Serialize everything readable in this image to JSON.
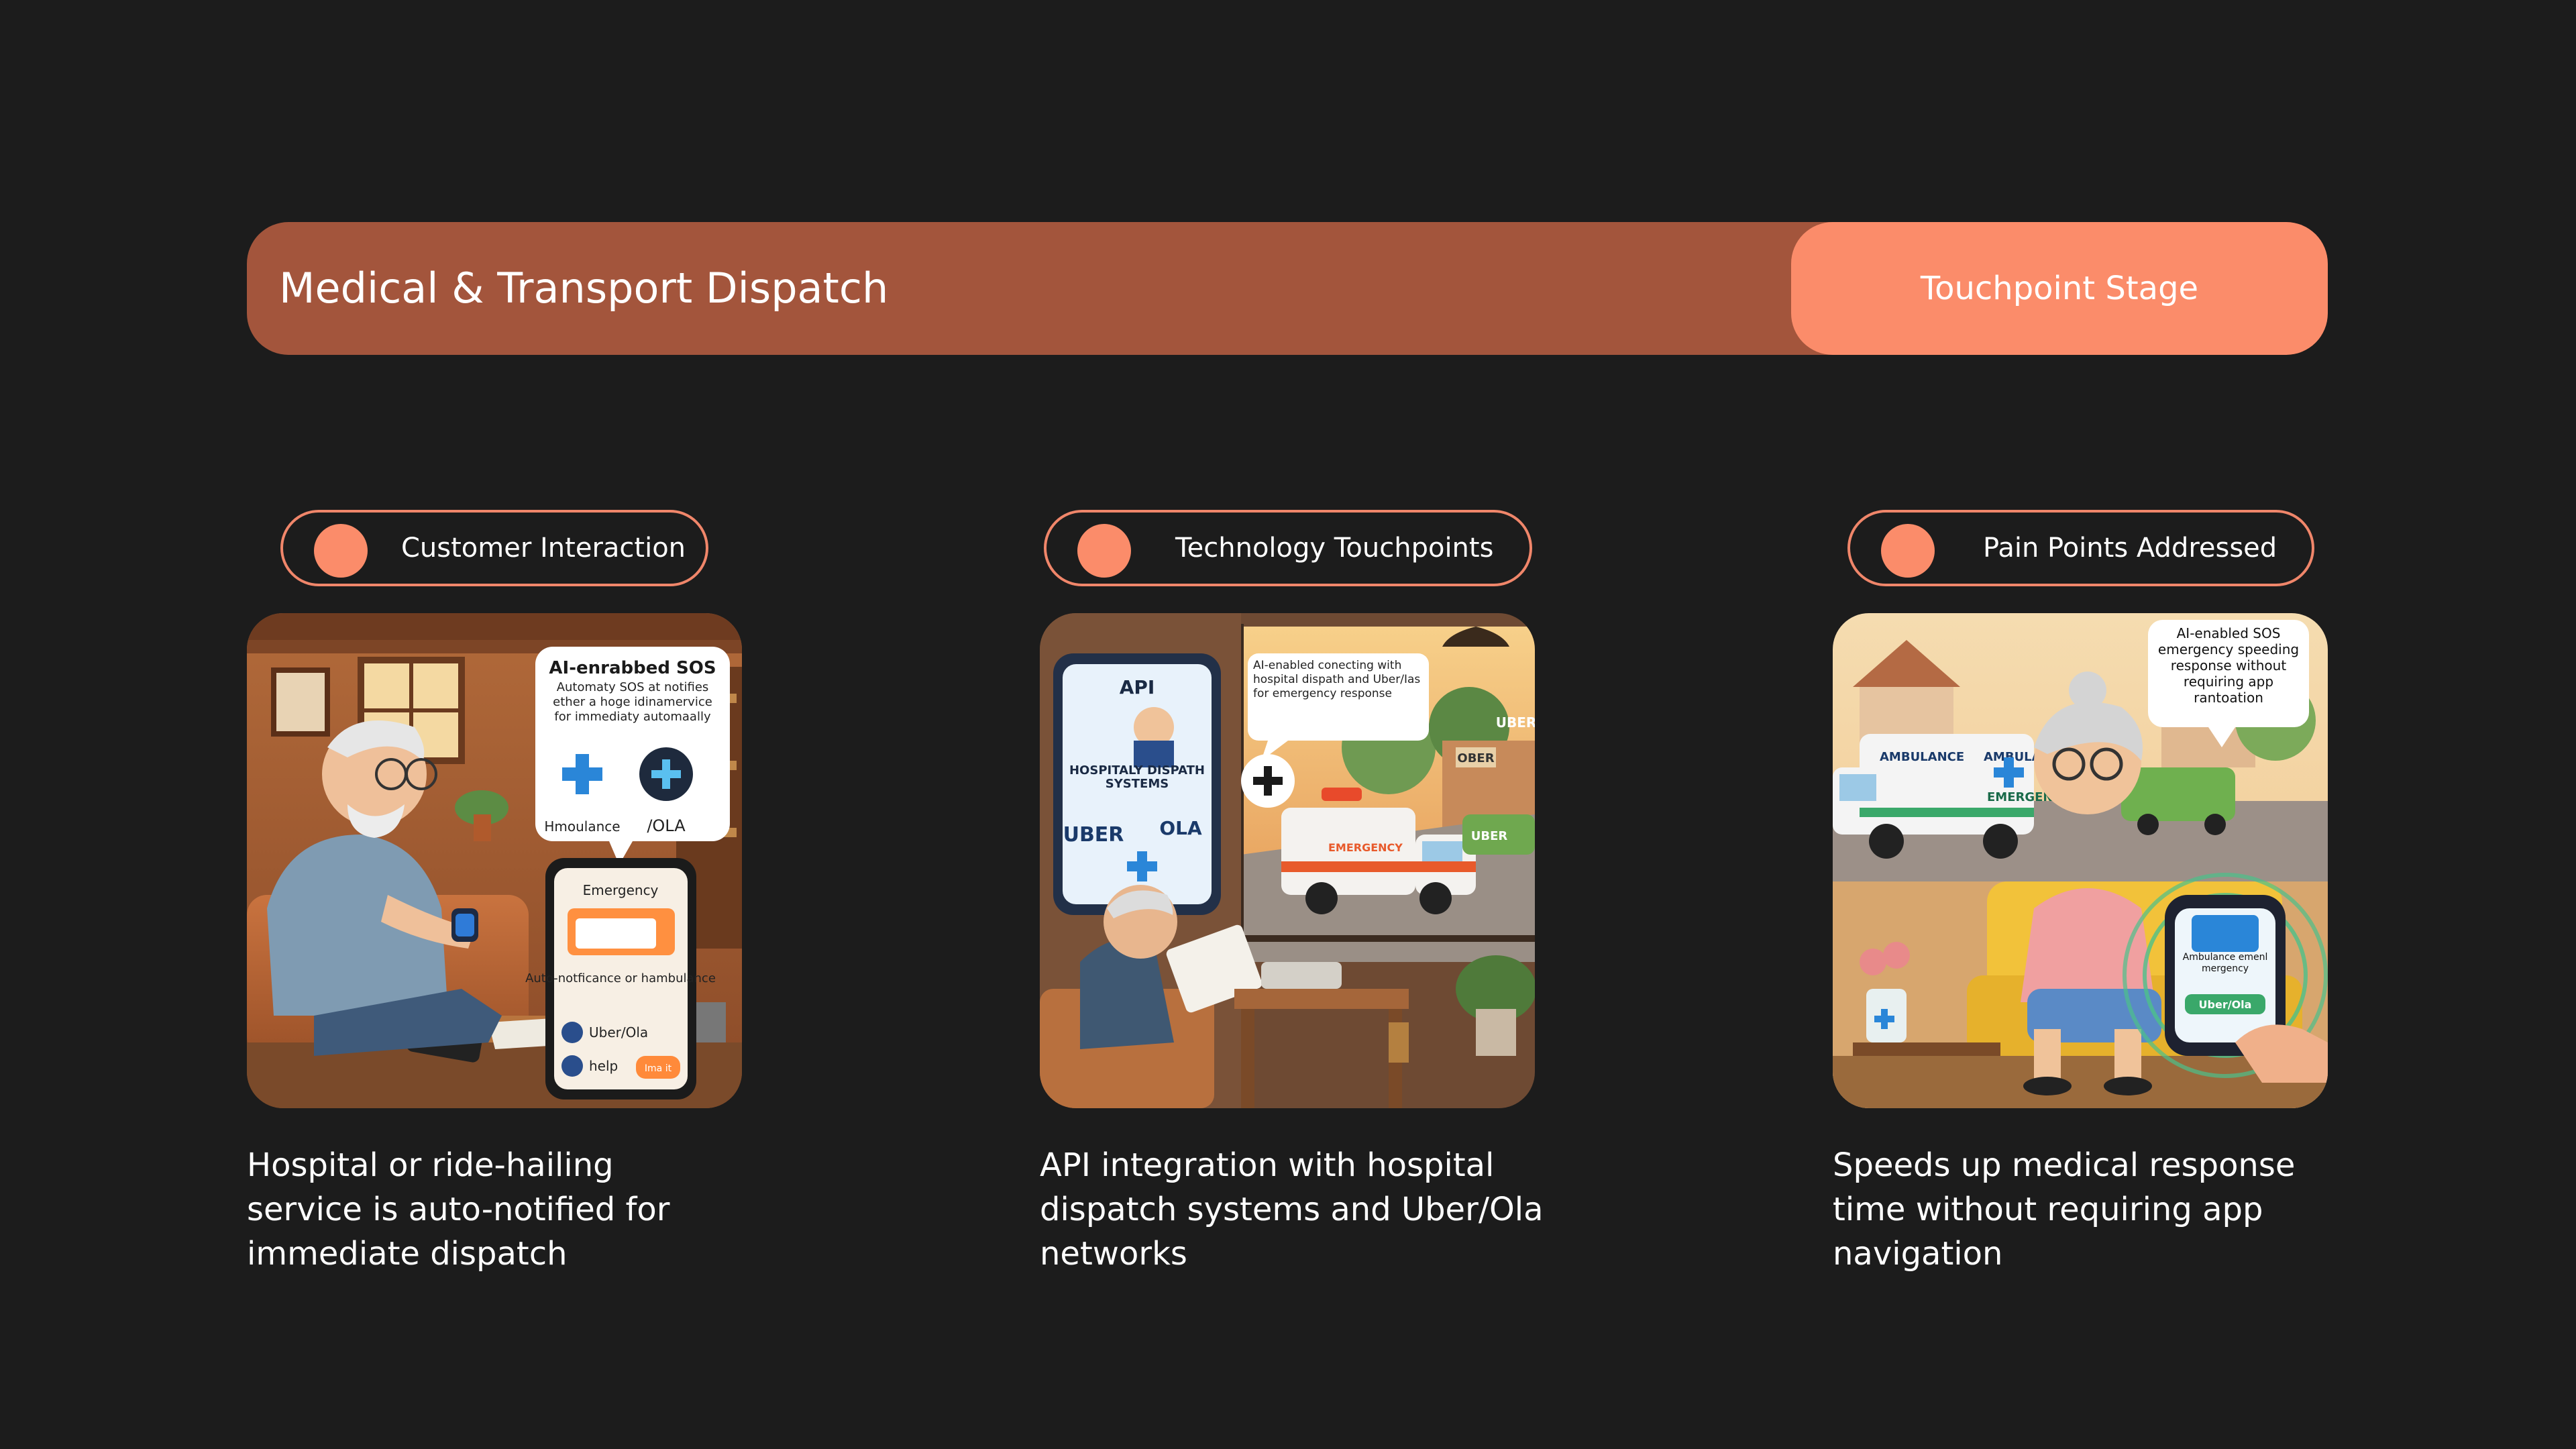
{
  "header": {
    "title": "Medical & Transport Dispatch",
    "stage_label": "Touchpoint Stage"
  },
  "columns": [
    {
      "label": "Customer Interaction",
      "description": "Hospital or ride-hailing service is auto-notified for immediate dispatch",
      "illustration": {
        "bubble_title": "AI-enrabbed SOS",
        "bubble_text": "Automaty SOS at notifies ether a hoge idinamervice for immediaty automaally",
        "left_icon_label": "Hmoulance",
        "right_icon_label": "/OLA",
        "phone_header": "Emergency",
        "phone_text": "Auto-notficance or hambulance",
        "phone_row": "Uber/Ola",
        "phone_help": "help",
        "phone_btn": "Ima it"
      }
    },
    {
      "label": "Technology Touchpoints",
      "description": "API integration with hospital dispatch systems and Uber/Ola networks",
      "illustration": {
        "phone_api": "API",
        "phone_caption": "HOSPITALY DISPATH SYSTEMS",
        "phone_uber": "UBER",
        "phone_ola": "OLA",
        "bubble_text": "AI-enabled conecting with hospital dispath and Uber/Ias for emergency response",
        "ambulance_text": "EMERGENCY",
        "building_sign": "OBER",
        "car_text": "UBER",
        "building_sign_2": "UBER"
      }
    },
    {
      "label": "Pain Points Addressed",
      "description": "Speeds up medical response time without requiring app navigation",
      "illustration": {
        "bubble_text": "AI-enabled SOS emergency speeding response without requiring app rantoation",
        "ambulance_label": "AMBULANCE",
        "ambulance_label_2": "AMBULAN",
        "ambulance_side": "EMERGENC",
        "watch_text": "Ambulance emenl mergency",
        "watch_btn": "Uber/Ola"
      }
    }
  ],
  "colors": {
    "background": "#1c1c1c",
    "header_bar": "#a3553c",
    "accent": "#fb8c6a",
    "text": "#ffffff"
  }
}
